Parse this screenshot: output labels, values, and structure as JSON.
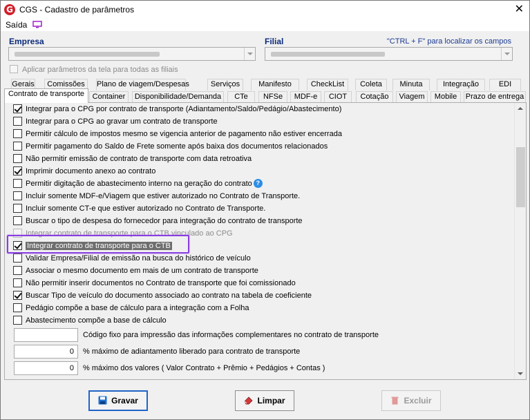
{
  "window": {
    "title": "CGS - Cadastro de parâmetros",
    "close_symbol": "✕",
    "app_icon_letter": "G"
  },
  "menu": {
    "saida_label": "Saída"
  },
  "filters": {
    "empresa_label": "Empresa",
    "filial_label": "Filial",
    "help_text": "\"CTRL + F\" para localizar os campos",
    "apply_all_label": "Aplicar parâmetros da tela para todas as filiais"
  },
  "tabs_row1": [
    "Gerais",
    "Comissões",
    "Plano de viagem/Despesas",
    "Serviços",
    "Manifesto",
    "CheckList",
    "Coleta",
    "Minuta",
    "Integração",
    "EDI"
  ],
  "tabs_row2": [
    "Contrato de transporte",
    "Container",
    "Disponibilidade/Demanda",
    "CTe",
    "NFSe",
    "MDF-e",
    "CIOT",
    "Cotação",
    "Viagem",
    "Mobile",
    "Prazo de entrega"
  ],
  "active_tab": "Contrato de transporte",
  "options": [
    {
      "label": "Integrar para o CPG por contrato de transporte (Adiantamento/Saldo/Pedágio/Abastecimento)",
      "checked": true,
      "disabled": false
    },
    {
      "label": "Integrar para o CPG ao gravar um contrato de transporte",
      "checked": false,
      "disabled": false
    },
    {
      "label": "Permitir cálculo de impostos mesmo se vigencia anterior de pagamento não estiver encerrada",
      "checked": false,
      "disabled": false
    },
    {
      "label": "Permitir pagamento do Saldo de Frete somente após baixa dos documentos relacionados",
      "checked": false,
      "disabled": false
    },
    {
      "label": "Não permitir emissão de contrato de transporte com data retroativa",
      "checked": false,
      "disabled": false
    },
    {
      "label": "Imprimir documento anexo ao contrato",
      "checked": true,
      "disabled": false
    },
    {
      "label": "Permitir digitação de abastecimento interno na geração do contrato",
      "checked": false,
      "disabled": false,
      "help": "?"
    },
    {
      "label": "Incluir somente MDF-e/Viagem que estiver autorizado no Contrato de Transporte.",
      "checked": false,
      "disabled": false
    },
    {
      "label": "Incluir somente CT-e que estiver autorizado no Contrato de Transporte.",
      "checked": false,
      "disabled": false
    },
    {
      "label": "Buscar o tipo de despesa do fornecedor para integração do contrato de transporte",
      "checked": false,
      "disabled": false
    },
    {
      "label": "Integrar contrato de transporte para o CTB vinculado ao CPG",
      "checked": false,
      "disabled": true
    },
    {
      "label": "Integrar contrato de transporte para o CTB",
      "checked": true,
      "disabled": false,
      "focused": true
    },
    {
      "label": "Validar Empresa/Filial de emissão na busca do histórico de veículo",
      "checked": false,
      "disabled": false
    },
    {
      "label": "Associar o mesmo documento em mais de um contrato de transporte",
      "checked": false,
      "disabled": false
    },
    {
      "label": "Não permitir inserir documentos no Contrato de transporte que foi comissionado",
      "checked": false,
      "disabled": false
    },
    {
      "label": "Buscar Tipo de veículo do documento associado ao contrato na tabela de coeficiente",
      "checked": true,
      "disabled": false
    },
    {
      "label": "Pedágio compõe a base de cálculo para a integração com a Folha",
      "checked": false,
      "disabled": false
    },
    {
      "label": "Abastecimento compõe a base de cálculo",
      "checked": false,
      "disabled": false
    }
  ],
  "fields": [
    {
      "value": "",
      "label": "Código fixo para impressão das informações complementares no contrato de transporte"
    },
    {
      "value": "0",
      "label": "% máximo de adiantamento liberado para contrato de transporte"
    },
    {
      "value": "0",
      "label": "% máximo dos valores ( Valor Contrato + Prêmio + Pedágios + Contas )"
    }
  ],
  "buttons": {
    "save": "Gravar",
    "clear": "Limpar",
    "delete": "Excluir"
  },
  "colors": {
    "highlight": "#8a3ee0",
    "primary_border": "#1f64c8",
    "app_icon": "#d21f2b",
    "help_badge": "#2d8de6"
  }
}
